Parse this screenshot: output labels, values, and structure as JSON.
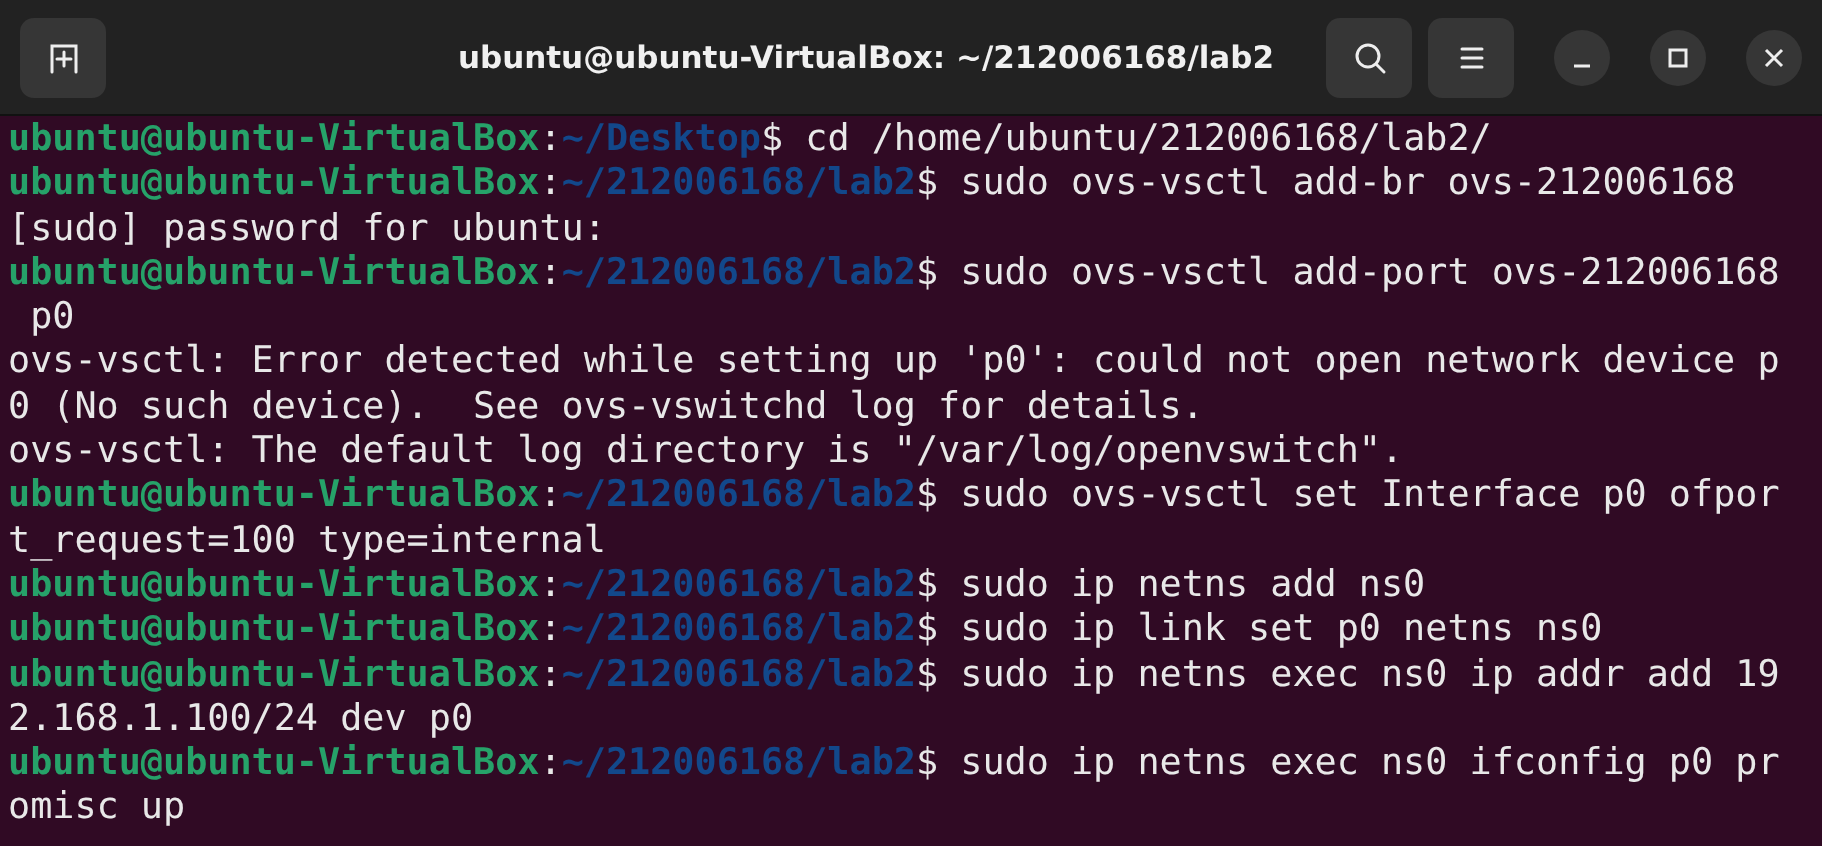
{
  "window": {
    "title": "ubuntu@ubuntu-VirtualBox: ~/212006168/lab2"
  },
  "terminal": {
    "lines": [
      {
        "kind": "prompt",
        "user_host": "ubuntu@ubuntu-VirtualBox",
        "separator": ":",
        "path": "~/Desktop",
        "prompt_sign": "$",
        "command": " cd /home/ubuntu/212006168/lab2/"
      },
      {
        "kind": "prompt",
        "user_host": "ubuntu@ubuntu-VirtualBox",
        "separator": ":",
        "path": "~/212006168/lab2",
        "prompt_sign": "$",
        "command": " sudo ovs-vsctl add-br ovs-212006168"
      },
      {
        "kind": "output",
        "text": "[sudo] password for ubuntu:"
      },
      {
        "kind": "prompt",
        "user_host": "ubuntu@ubuntu-VirtualBox",
        "separator": ":",
        "path": "~/212006168/lab2",
        "prompt_sign": "$",
        "command": " sudo ovs-vsctl add-port ovs-212006168"
      },
      {
        "kind": "output",
        "text": " p0"
      },
      {
        "kind": "output",
        "text": "ovs-vsctl: Error detected while setting up 'p0': could not open network device p"
      },
      {
        "kind": "output",
        "text": "0 (No such device).  See ovs-vswitchd log for details."
      },
      {
        "kind": "output",
        "text": "ovs-vsctl: The default log directory is \"/var/log/openvswitch\"."
      },
      {
        "kind": "prompt",
        "user_host": "ubuntu@ubuntu-VirtualBox",
        "separator": ":",
        "path": "~/212006168/lab2",
        "prompt_sign": "$",
        "command": " sudo ovs-vsctl set Interface p0 ofpor"
      },
      {
        "kind": "output",
        "text": "t_request=100 type=internal"
      },
      {
        "kind": "prompt",
        "user_host": "ubuntu@ubuntu-VirtualBox",
        "separator": ":",
        "path": "~/212006168/lab2",
        "prompt_sign": "$",
        "command": " sudo ip netns add ns0"
      },
      {
        "kind": "prompt",
        "user_host": "ubuntu@ubuntu-VirtualBox",
        "separator": ":",
        "path": "~/212006168/lab2",
        "prompt_sign": "$",
        "command": " sudo ip link set p0 netns ns0"
      },
      {
        "kind": "prompt",
        "user_host": "ubuntu@ubuntu-VirtualBox",
        "separator": ":",
        "path": "~/212006168/lab2",
        "prompt_sign": "$",
        "command": " sudo ip netns exec ns0 ip addr add 19"
      },
      {
        "kind": "output",
        "text": "2.168.1.100/24 dev p0"
      },
      {
        "kind": "prompt",
        "user_host": "ubuntu@ubuntu-VirtualBox",
        "separator": ":",
        "path": "~/212006168/lab2",
        "prompt_sign": "$",
        "command": " sudo ip netns exec ns0 ifconfig p0 pr"
      },
      {
        "kind": "output",
        "text": "omisc up"
      }
    ]
  }
}
